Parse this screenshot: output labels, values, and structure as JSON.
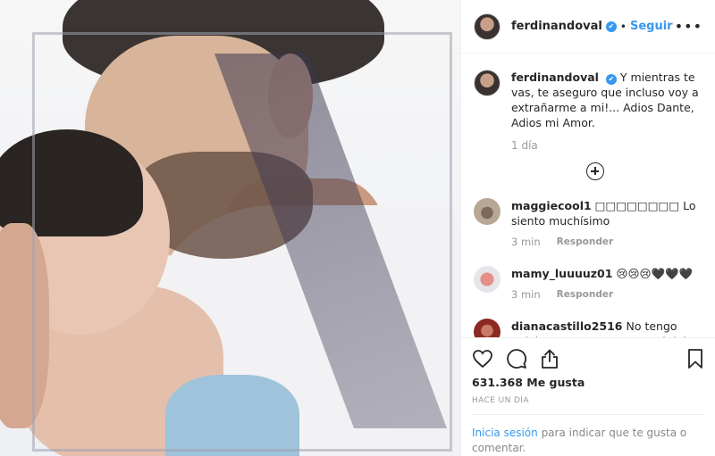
{
  "header": {
    "username": "ferdinandoval",
    "verified_mark": "✔",
    "separator": "•",
    "follow_label": "Seguir",
    "more_label": "•••"
  },
  "caption": {
    "username": "ferdinandoval",
    "text": "Y mientras te vas, te aseguro que incluso voy a extrañarme a mi!... Adios Dante, Adios mi Amor.",
    "time": "1 día"
  },
  "comments": [
    {
      "username": "maggiecool1",
      "text": "□□□□□□□□ Lo siento muchísimo",
      "time": "3 min",
      "reply_label": "Responder"
    },
    {
      "username": "mamy_luuuuz01",
      "text": "😢😢😢🖤🖤🖤",
      "time": "3 min",
      "reply_label": "Responder"
    },
    {
      "username": "dianacastillo2516",
      "text": "No tengo palabras para expresarte el dolor que siento a pesar de no conocerlos...lo siento",
      "time": "",
      "reply_label": ""
    }
  ],
  "actions": {
    "likes": "631.368 Me gusta",
    "date": "HACE UN DÍA"
  },
  "login": {
    "link": "Inicia sesión",
    "rest": " para indicar que te gusta o comentar."
  },
  "icons": [
    "more-options-icon",
    "load-more-comments-icon",
    "heart-icon",
    "comment-icon",
    "share-icon",
    "bookmark-icon"
  ],
  "colors": {
    "link": "#3897f0",
    "verified": "#3897f0",
    "muted": "#999999"
  }
}
